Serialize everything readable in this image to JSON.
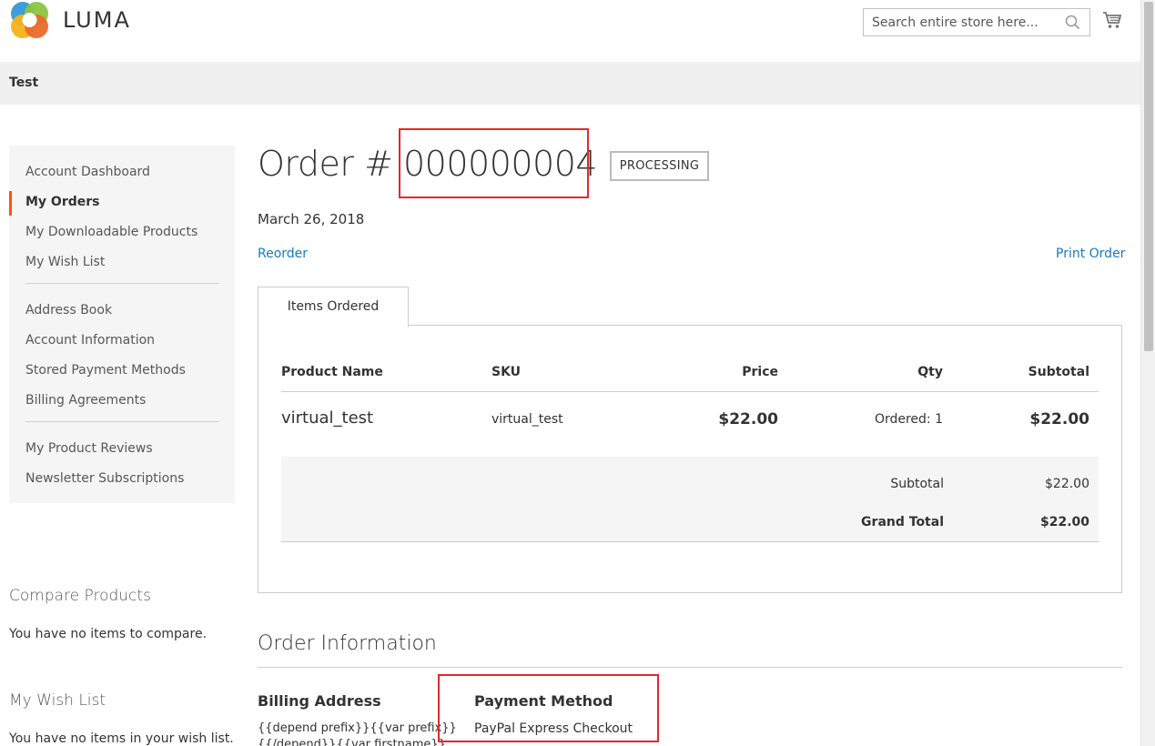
{
  "header": {
    "logo_text": "LUMA",
    "search_placeholder": "Search entire store here..."
  },
  "page_title": "Test",
  "sidebar": {
    "items": [
      {
        "label": "Account Dashboard",
        "active": false
      },
      {
        "label": "My Orders",
        "active": true
      },
      {
        "label": "My Downloadable Products",
        "active": false
      },
      {
        "label": "My Wish List",
        "active": false
      },
      {
        "label": "Address Book",
        "active": false
      },
      {
        "label": "Account Information",
        "active": false
      },
      {
        "label": "Stored Payment Methods",
        "active": false
      },
      {
        "label": "Billing Agreements",
        "active": false
      },
      {
        "label": "My Product Reviews",
        "active": false
      },
      {
        "label": "Newsletter Subscriptions",
        "active": false
      }
    ]
  },
  "compare": {
    "title": "Compare Products",
    "empty": "You have no items to compare."
  },
  "wishlist": {
    "title": "My Wish List",
    "empty": "You have no items in your wish list."
  },
  "order": {
    "title_prefix": "Order # ",
    "number": "000000004",
    "status": "PROCESSING",
    "date": "March 26, 2018",
    "reorder": "Reorder",
    "print": "Print Order"
  },
  "tabs": {
    "items_ordered": "Items Ordered"
  },
  "table": {
    "headers": {
      "product": "Product Name",
      "sku": "SKU",
      "price": "Price",
      "qty": "Qty",
      "subtotal": "Subtotal"
    },
    "rows": [
      {
        "product": "virtual_test",
        "sku": "virtual_test",
        "price": "$22.00",
        "qty": "Ordered: 1",
        "subtotal": "$22.00"
      }
    ],
    "totals": {
      "subtotal_label": "Subtotal",
      "subtotal_value": "$22.00",
      "grand_label": "Grand Total",
      "grand_value": "$22.00"
    }
  },
  "order_info": {
    "title": "Order Information",
    "billing_title": "Billing Address",
    "billing_line1": "{{depend prefix}}{{var prefix}}",
    "billing_line2": "{{/depend}}{{var firstname}}",
    "payment_title": "Payment Method",
    "payment_value": "PayPal Express Checkout"
  },
  "colors": {
    "accent": "#ff5501",
    "link": "#1979c3",
    "highlight": "#e02b27"
  }
}
